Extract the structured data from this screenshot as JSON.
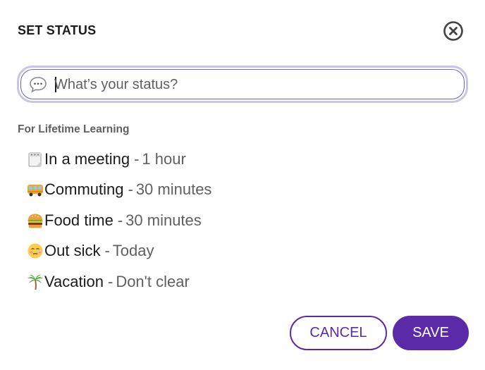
{
  "dialog": {
    "title": "SET STATUS",
    "close_icon": "close-circle-icon"
  },
  "search": {
    "placeholder": "What’s your status?",
    "value": "",
    "icon": "speech-bubble-icon"
  },
  "section": {
    "label": "For Lifetime Learning"
  },
  "statuses": [
    {
      "icon": "calendar-icon",
      "label": "In a meeting",
      "separator": "-",
      "duration": "1 hour"
    },
    {
      "icon": "bus-icon",
      "label": "Commuting",
      "separator": "-",
      "duration": "30 minutes"
    },
    {
      "icon": "burger-icon",
      "label": "Food time",
      "separator": "-",
      "duration": "30 minutes"
    },
    {
      "icon": "sick-face-icon",
      "label": "Out sick",
      "separator": "-",
      "duration": "Today"
    },
    {
      "icon": "palm-tree-icon",
      "label": "Vacation",
      "separator": "-",
      "duration": "Don't clear"
    }
  ],
  "buttons": {
    "cancel": "CANCEL",
    "save": "SAVE"
  },
  "colors": {
    "accent": "#5b2aa8",
    "input_focus_ring": "#c9c5e8",
    "muted_text": "#616061"
  }
}
